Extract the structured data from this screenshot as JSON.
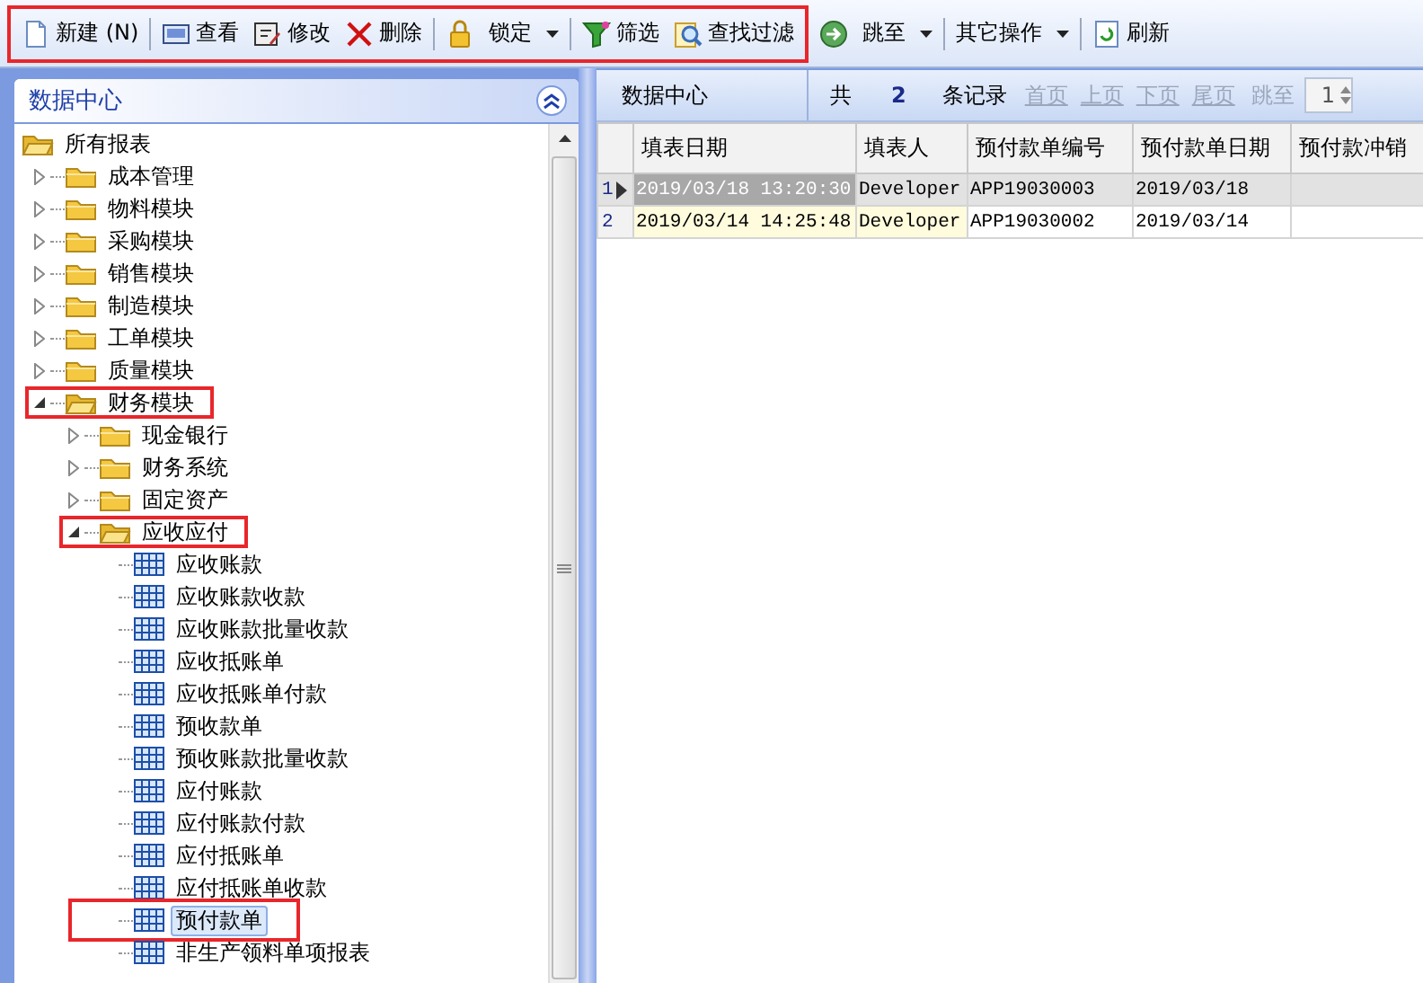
{
  "toolbar": {
    "groups": [
      {
        "annotated": true,
        "items": [
          {
            "label": "新建 (N)",
            "dropdown": false
          },
          {
            "label": "查看",
            "dropdown": false
          },
          {
            "label": "修改",
            "dropdown": false
          },
          {
            "label": "删除",
            "dropdown": false
          },
          {
            "label": "锁定",
            "dropdown": true
          },
          {
            "label": "筛选",
            "dropdown": false
          },
          {
            "label": "查找过滤",
            "dropdown": false
          }
        ]
      },
      {
        "annotated": false,
        "items": [
          {
            "label": "跳至",
            "dropdown": true
          },
          {
            "label": "其它操作",
            "dropdown": true
          },
          {
            "label": "刷新",
            "dropdown": false
          }
        ]
      }
    ]
  },
  "sidebar": {
    "title": "数据中心",
    "tree": [
      {
        "label": "所有报表",
        "kind": "folder",
        "expanded": true,
        "selected": false,
        "annotated": false,
        "children": [
          {
            "label": "成本管理",
            "kind": "folder",
            "expanded": false,
            "selected": false,
            "annotated": false
          },
          {
            "label": "物料模块",
            "kind": "folder",
            "expanded": false,
            "selected": false,
            "annotated": false
          },
          {
            "label": "采购模块",
            "kind": "folder",
            "expanded": false,
            "selected": false,
            "annotated": false
          },
          {
            "label": "销售模块",
            "kind": "folder",
            "expanded": false,
            "selected": false,
            "annotated": false
          },
          {
            "label": "制造模块",
            "kind": "folder",
            "expanded": false,
            "selected": false,
            "annotated": false
          },
          {
            "label": "工单模块",
            "kind": "folder",
            "expanded": false,
            "selected": false,
            "annotated": false
          },
          {
            "label": "质量模块",
            "kind": "folder",
            "expanded": false,
            "selected": false,
            "annotated": false
          },
          {
            "label": "财务模块",
            "kind": "folder",
            "expanded": true,
            "selected": false,
            "annotated": true,
            "children": [
              {
                "label": "现金银行",
                "kind": "folder",
                "expanded": false,
                "selected": false,
                "annotated": false
              },
              {
                "label": "财务系统",
                "kind": "folder",
                "expanded": false,
                "selected": false,
                "annotated": false
              },
              {
                "label": "固定资产",
                "kind": "folder",
                "expanded": false,
                "selected": false,
                "annotated": false
              },
              {
                "label": "应收应付",
                "kind": "folder",
                "expanded": true,
                "selected": false,
                "annotated": true,
                "children": [
                  {
                    "label": "应收账款",
                    "kind": "report",
                    "selected": false,
                    "annotated": false
                  },
                  {
                    "label": "应收账款收款",
                    "kind": "report",
                    "selected": false,
                    "annotated": false
                  },
                  {
                    "label": "应收账款批量收款",
                    "kind": "report",
                    "selected": false,
                    "annotated": false
                  },
                  {
                    "label": "应收抵账单",
                    "kind": "report",
                    "selected": false,
                    "annotated": false
                  },
                  {
                    "label": "应收抵账单付款",
                    "kind": "report",
                    "selected": false,
                    "annotated": false
                  },
                  {
                    "label": "预收款单",
                    "kind": "report",
                    "selected": false,
                    "annotated": false
                  },
                  {
                    "label": "预收账款批量收款",
                    "kind": "report",
                    "selected": false,
                    "annotated": false
                  },
                  {
                    "label": "应付账款",
                    "kind": "report",
                    "selected": false,
                    "annotated": false
                  },
                  {
                    "label": "应付账款付款",
                    "kind": "report",
                    "selected": false,
                    "annotated": false
                  },
                  {
                    "label": "应付抵账单",
                    "kind": "report",
                    "selected": false,
                    "annotated": false
                  },
                  {
                    "label": "应付抵账单收款",
                    "kind": "report",
                    "selected": false,
                    "annotated": false
                  },
                  {
                    "label": "预付款单",
                    "kind": "report",
                    "selected": true,
                    "annotated": true
                  },
                  {
                    "label": "非生产领料单项报表",
                    "kind": "report",
                    "selected": false,
                    "annotated": false
                  }
                ]
              }
            ]
          }
        ]
      }
    ]
  },
  "pager": {
    "title": "数据中心",
    "total_prefix": "共",
    "total": "2",
    "total_suffix": "条记录",
    "links": [
      {
        "label": "首页",
        "disabled": true
      },
      {
        "label": "上页",
        "disabled": true
      },
      {
        "label": "下页",
        "disabled": true
      },
      {
        "label": "尾页",
        "disabled": true
      }
    ],
    "jump": {
      "label": "跳至",
      "disabled": true,
      "value": "1"
    }
  },
  "table": {
    "columns": [
      "填表日期",
      "填表人",
      "预付款单编号",
      "预付款单日期",
      "预付款冲销"
    ],
    "rows": [
      {
        "number": "1",
        "selected": true,
        "cells": [
          "2019/03/18 13:20:30",
          "Developer",
          "APP19030003",
          "2019/03/18",
          ""
        ]
      },
      {
        "number": "2",
        "selected": false,
        "cells": [
          "2019/03/14 14:25:48",
          "Developer",
          "APP19030002",
          "2019/03/14",
          ""
        ]
      }
    ]
  }
}
